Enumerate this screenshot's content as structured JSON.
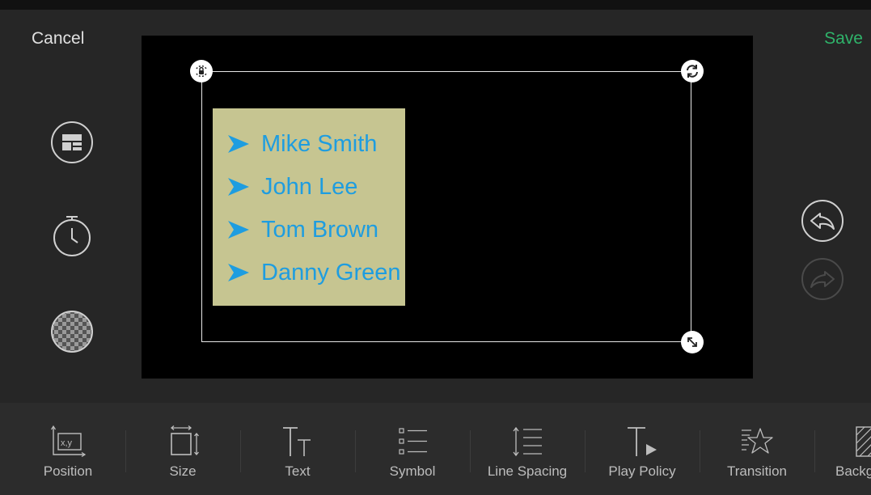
{
  "header": {
    "cancel_label": "Cancel",
    "save_label": "Save"
  },
  "colors": {
    "accent_save": "#2fb36a",
    "list_text": "#1e9de0",
    "textbox_bg": "#c6c591",
    "canvas_bg": "#000000"
  },
  "list": {
    "items": [
      {
        "label": "Mike Smith"
      },
      {
        "label": "John Lee"
      },
      {
        "label": "Tom Brown"
      },
      {
        "label": "Danny Green"
      }
    ]
  },
  "left_tools": [
    {
      "icon": "layout-icon"
    },
    {
      "icon": "timer-icon"
    },
    {
      "icon": "transparency-icon"
    }
  ],
  "right_tools": [
    {
      "icon": "undo-icon",
      "enabled": true
    },
    {
      "icon": "redo-icon",
      "enabled": false
    }
  ],
  "toolbar": {
    "items": [
      {
        "label": "Position",
        "icon": "position-icon"
      },
      {
        "label": "Size",
        "icon": "size-icon"
      },
      {
        "label": "Text",
        "icon": "text-icon"
      },
      {
        "label": "Symbol",
        "icon": "symbol-icon"
      },
      {
        "label": "Line Spacing",
        "icon": "line-spacing-icon"
      },
      {
        "label": "Play Policy",
        "icon": "play-policy-icon"
      },
      {
        "label": "Transition",
        "icon": "transition-icon"
      },
      {
        "label": "Backg",
        "icon": "background-icon"
      }
    ]
  },
  "position_icon_text": "x,y"
}
